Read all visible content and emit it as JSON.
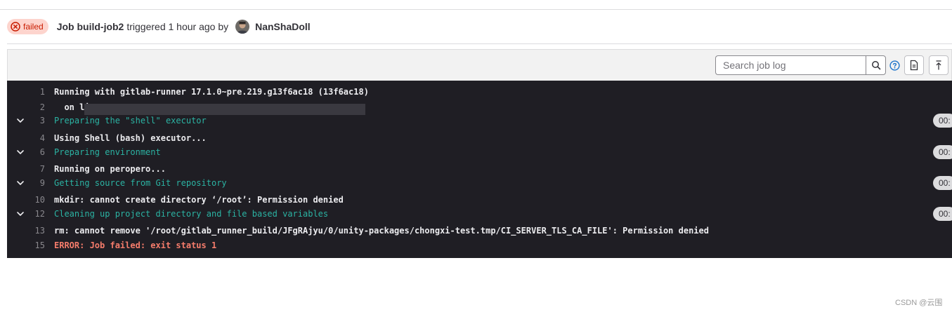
{
  "header": {
    "status": "failed",
    "job_name": "Job build-job2",
    "triggered_text": "triggered 1 hour ago by",
    "author": "NanShaDoll"
  },
  "toolbar": {
    "search_placeholder": "Search job log"
  },
  "log": {
    "lines": [
      {
        "num": "1",
        "text": "Running with gitlab-runner 17.1.0~pre.219.g13f6ac18 (13f6ac18)"
      },
      {
        "num": "2",
        "text": "  on li"
      },
      {
        "num": "3",
        "text": "Preparing the \"shell\" executor",
        "duration": "00:"
      },
      {
        "num": "4",
        "text": "Using Shell (bash) executor..."
      },
      {
        "num": "6",
        "text": "Preparing environment",
        "duration": "00:"
      },
      {
        "num": "7",
        "text": "Running on peropero..."
      },
      {
        "num": "9",
        "text": "Getting source from Git repository",
        "duration": "00:"
      },
      {
        "num": "10",
        "text": "mkdir: cannot create directory ‘/root’: Permission denied"
      },
      {
        "num": "12",
        "text": "Cleaning up project directory and file based variables",
        "duration": "00:"
      },
      {
        "num": "13",
        "text": "rm: cannot remove '/root/gitlab_runner_build/JFgRAjyu/0/unity-packages/chongxi-test.tmp/CI_SERVER_TLS_CA_FILE': Permission denied"
      },
      {
        "num": "15",
        "text": "ERROR: Job failed: exit status 1"
      }
    ]
  },
  "watermark": "CSDN @云围"
}
